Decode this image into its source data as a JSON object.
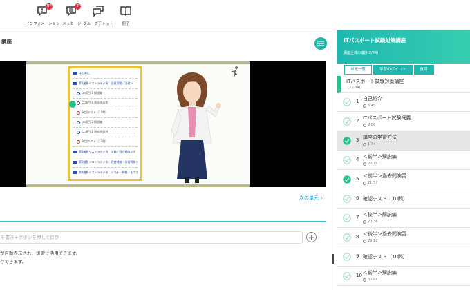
{
  "toolbar": {
    "items": [
      {
        "label": "インフォメーション",
        "icon": "alert-chat-icon",
        "badge": "97"
      },
      {
        "label": "メッセージ",
        "icon": "message-icon",
        "badge": "7"
      },
      {
        "label": "グループチャット",
        "icon": "group-chat-icon",
        "badge": ""
      },
      {
        "label": "冊子",
        "icon": "book-icon",
        "badge": ""
      }
    ]
  },
  "main": {
    "title": "講座",
    "next_label": "次の単元 〉",
    "memo_placeholder": "を書き＋ボタンを押して保存",
    "notes": [
      "が自動表示され、復習に活用できます。",
      "存できます。"
    ]
  },
  "slide": {
    "menu": [
      {
        "text": "はじめに",
        "kind": "chapter"
      },
      {
        "text": "第1階層＜ストラテジ系：企業活動／法務＞",
        "kind": "chapter"
      },
      {
        "text": "二項目 1 解説編",
        "kind": "lesson"
      },
      {
        "text": "二項目 1 過去問演習",
        "kind": "lesson"
      },
      {
        "text": "確認テスト（10問）",
        "kind": "test"
      },
      {
        "text": "二項目 2 解説編",
        "kind": "lesson"
      },
      {
        "text": "二項目 2 過去問演習",
        "kind": "lesson"
      },
      {
        "text": "確認テスト（10問）",
        "kind": "test"
      },
      {
        "text": "第2階層＜ストラテジ系：法務／経営戦略マネ",
        "kind": "chapter"
      },
      {
        "text": "第3階層＜ストラテジ系：経営戦略・技術戦略＞",
        "kind": "chapter"
      },
      {
        "text": "第4階層＜ストラテジ系：システム戦略／までの",
        "kind": "chapter"
      }
    ]
  },
  "sidebar": {
    "title": "ITパスポート試験対策講座",
    "progress": "講座全体の進捗(2/84)",
    "tabs": [
      "単元一覧",
      "学習のポイント",
      "質問"
    ],
    "section": {
      "title": "ITパスポート試験対策講座",
      "count": "(2 / 84)"
    },
    "lessons": [
      {
        "num": "1",
        "title": "自己紹介",
        "duration": "6:45",
        "done": false
      },
      {
        "num": "2",
        "title": "ITパスポート試験概要",
        "duration": "9:06",
        "done": false
      },
      {
        "num": "3",
        "title": "講座の学習方法",
        "duration": "1:44",
        "done": true,
        "current": true
      },
      {
        "num": "4",
        "title": "＜前半＞解説編",
        "duration": "22:15",
        "done": false
      },
      {
        "num": "5",
        "title": "＜前半＞過去問演習",
        "duration": "21:57",
        "done": true
      },
      {
        "num": "6",
        "title": "確認テスト（10問）",
        "duration": "",
        "done": false
      },
      {
        "num": "7",
        "title": "＜後半＞解説編",
        "duration": "20:36",
        "done": false
      },
      {
        "num": "8",
        "title": "＜後半＞過去問演習",
        "duration": "29:12",
        "done": false
      },
      {
        "num": "9",
        "title": "確認テスト（10問）",
        "duration": "",
        "done": false
      },
      {
        "num": "10",
        "title": "＜前半＞解説編",
        "duration": "30:48",
        "done": false
      }
    ]
  },
  "colors": {
    "accent": "#1fb8b0",
    "done": "#2ac08a",
    "badge": "#e8334a",
    "link": "#1e9ed8"
  }
}
